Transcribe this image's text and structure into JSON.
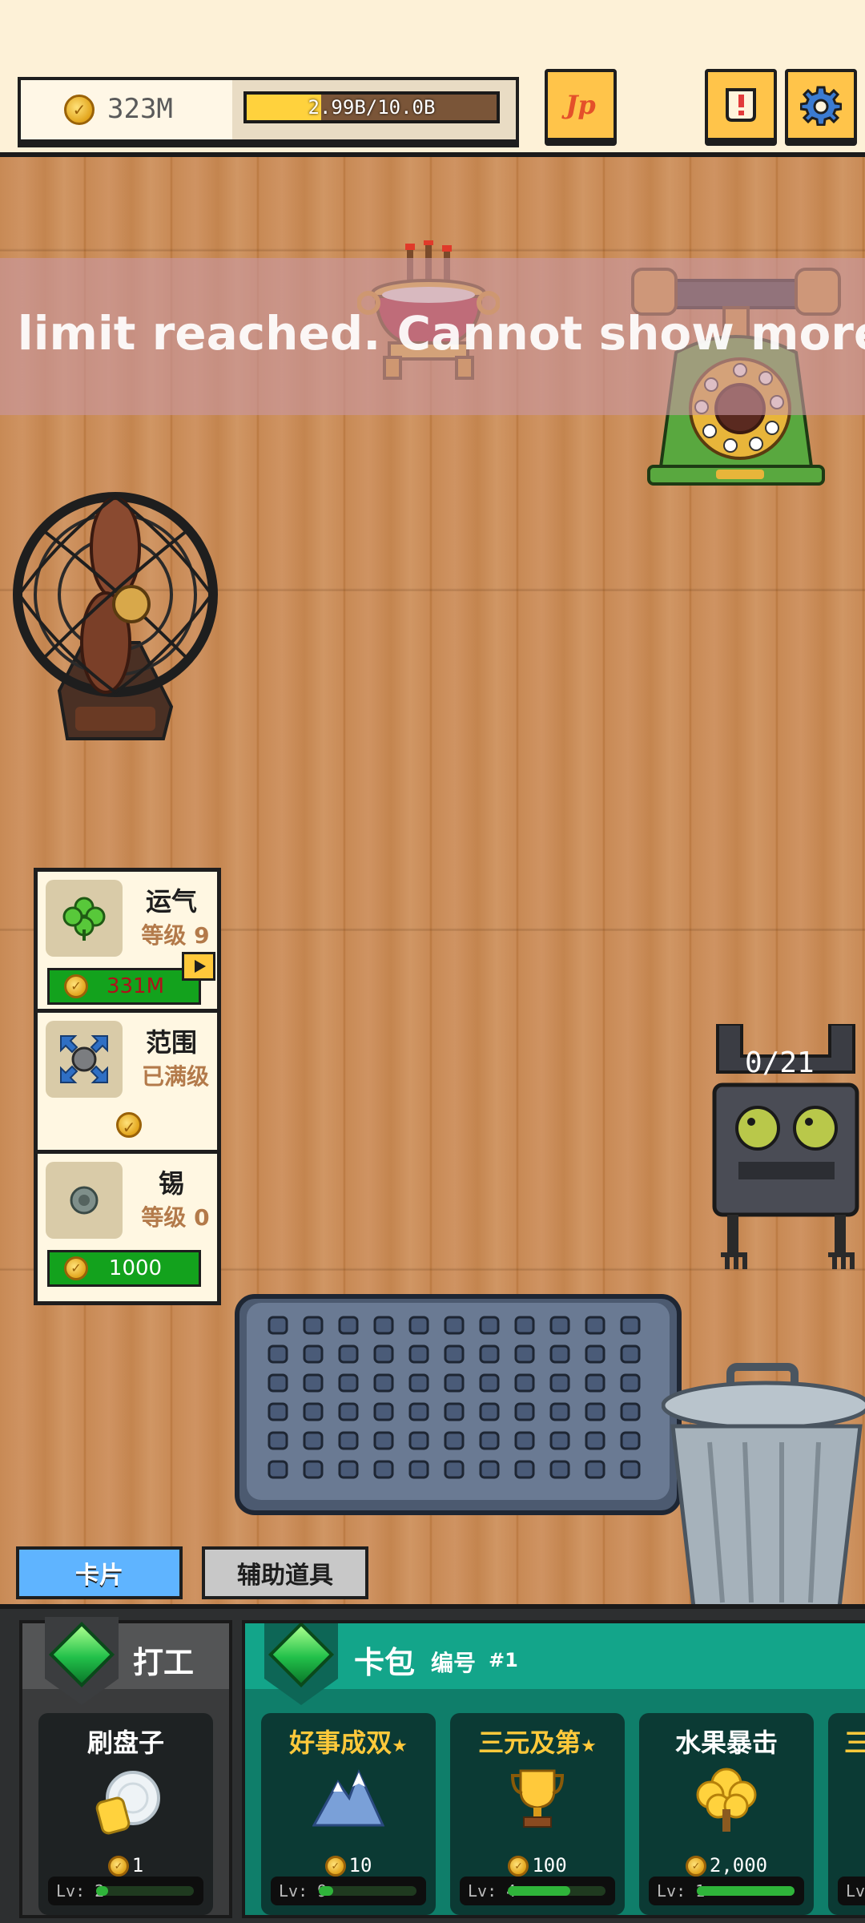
{
  "header": {
    "coins": "323M",
    "progress_text": "2.99B/10.0B",
    "progress_fraction": 0.299,
    "jp_label": "Jp",
    "quest_icon": "scroll-alert-icon",
    "settings_icon": "gear-icon"
  },
  "ad_banner": {
    "text": "d limit reached. Cannot show more ads"
  },
  "upgrades": [
    {
      "name": "运气",
      "level": "等级 9",
      "cost": "331M",
      "icon": "clover-icon",
      "has_video": true
    },
    {
      "name": "范围",
      "level": "已满级",
      "cost": "",
      "icon": "expand-arrows-icon",
      "has_video": false
    },
    {
      "name": "锡",
      "level": "等级 0",
      "cost": "1000",
      "icon": "tin-coin-icon",
      "has_video": false
    }
  ],
  "counter": "0/21",
  "tabs": {
    "cards": "卡片",
    "tools": "辅助道具"
  },
  "work": {
    "title": "打工",
    "card": {
      "title": "刷盘子",
      "price": "1",
      "level": "Lv: 2",
      "level_fraction": 0.12
    }
  },
  "pack": {
    "title": "卡包",
    "subtitle": "编号",
    "number": "#1",
    "cards": [
      {
        "title": "好事成双",
        "star": "★",
        "price": "10",
        "level": "Lv: 9",
        "level_fraction": 0.15,
        "icon": "mountain-icon"
      },
      {
        "title": "三元及第",
        "star": "★",
        "price": "100",
        "level": "Lv: 4",
        "level_fraction": 0.64,
        "icon": "trophy-icon"
      },
      {
        "title": "水果暴击",
        "star": "",
        "price": "2,000",
        "level": "Lv: 1",
        "level_fraction": 1.0,
        "icon": "golden-tree-icon"
      },
      {
        "title": "三",
        "star": "",
        "price": "",
        "level": "Lv",
        "level_fraction": 0.0,
        "icon": ""
      }
    ]
  }
}
